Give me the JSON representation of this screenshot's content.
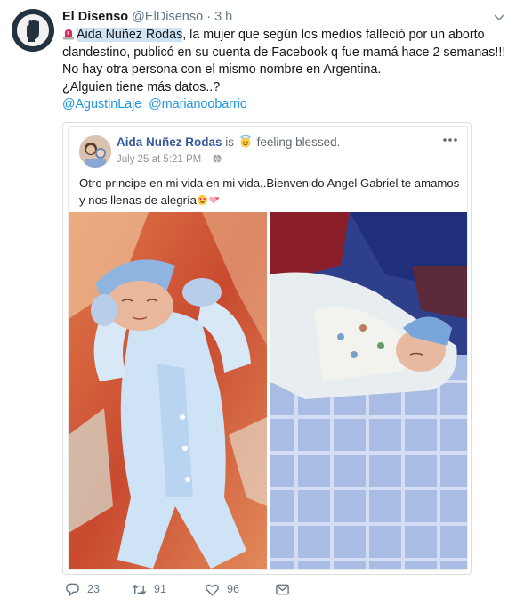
{
  "tweet": {
    "author_name": "El Disenso",
    "author_handle": "@ElDisenso",
    "separator": "·",
    "time": "3 h",
    "highlighted_name": "Aida Nuñez Rodas",
    "line1_rest": ", la mujer que según los medios falleció por un aborto",
    "line2": "clandestino, publicó en su cuenta de Facebook q fue mamá hace 2 semanas!!!",
    "line3": "No hay otra persona con el mismo nombre en Argentina.",
    "line4": "¿Alguien tiene más datos..?",
    "mentions": [
      "@AgustinLaje",
      "@marianoobarrio"
    ]
  },
  "embedded_post": {
    "name": "Aida Nuñez Rodas",
    "is_text": "is",
    "feeling": "feeling blessed.",
    "date": "July 25 at 5:21 PM ·",
    "text": "Otro principe en mi vida en mi vida..Bienvenido Angel Gabriel te amamos y nos llenas de alegría"
  },
  "actions": {
    "replies": "23",
    "retweets": "91",
    "likes": "96"
  },
  "colors": {
    "link": "#1b95e0",
    "muted": "#657786",
    "fb_name": "#365899",
    "highlight": "#cfe3f5"
  },
  "icons": [
    "siren-icon",
    "caret-down-icon",
    "reply-icon",
    "retweet-icon",
    "heart-icon",
    "direct-message-icon",
    "globe-icon",
    "more-icon",
    "smiling-face-with-halo-icon",
    "heart-eyes-icon",
    "hearts-icon"
  ]
}
